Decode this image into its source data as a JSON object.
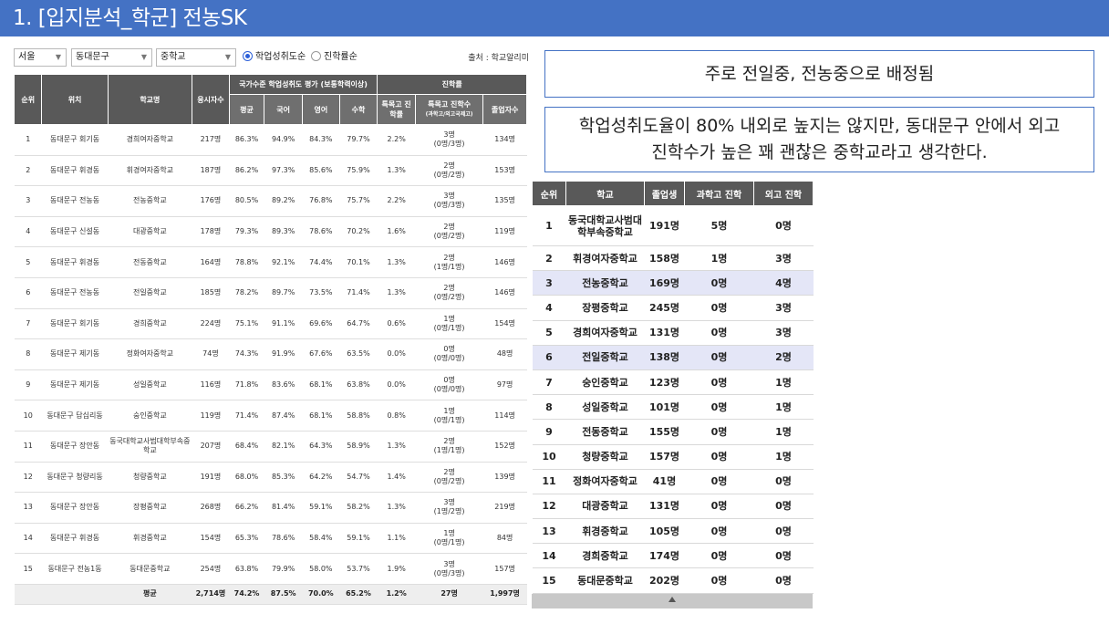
{
  "title": "1. [입지분석_학군] 전농SK",
  "filters": {
    "region": "서울",
    "district": "동대문구",
    "level": "중학교",
    "radio_options": [
      {
        "label": "학업성취도순",
        "selected": true
      },
      {
        "label": "진학률순",
        "selected": false
      }
    ],
    "source": "출처 : 학교알리미"
  },
  "left_table": {
    "headers": {
      "rank": "순위",
      "location": "위치",
      "school": "학교명",
      "students": "응시자수",
      "achievement_group": "국가수준 학업성취도 평가 (보통학력이상)",
      "avg": "평균",
      "korean": "국어",
      "english": "영어",
      "math": "수학",
      "advance_group": "진학률",
      "special_rate": "특목고 진학률",
      "special_count": "특목고 진학수",
      "special_count_sub": "(과학고/외고국제고)",
      "graduates": "졸업자수"
    },
    "rows": [
      {
        "rank": "1",
        "location": "동대문구 회기동",
        "school": "경희여자중학교",
        "students": "217명",
        "avg": "86.3%",
        "korean": "94.9%",
        "english": "84.3%",
        "math": "79.7%",
        "special_rate": "2.2%",
        "special_count": "3명",
        "special_detail": "(0명/3명)",
        "graduates": "134명"
      },
      {
        "rank": "2",
        "location": "동대문구 휘경동",
        "school": "휘경여자중학교",
        "students": "187명",
        "avg": "86.2%",
        "korean": "97.3%",
        "english": "85.6%",
        "math": "75.9%",
        "special_rate": "1.3%",
        "special_count": "2명",
        "special_detail": "(0명/2명)",
        "graduates": "153명"
      },
      {
        "rank": "3",
        "location": "동대문구 전농동",
        "school": "전농중학교",
        "students": "176명",
        "avg": "80.5%",
        "korean": "89.2%",
        "english": "76.8%",
        "math": "75.7%",
        "special_rate": "2.2%",
        "special_count": "3명",
        "special_detail": "(0명/3명)",
        "graduates": "135명"
      },
      {
        "rank": "4",
        "location": "동대문구 신설동",
        "school": "대광중학교",
        "students": "178명",
        "avg": "79.3%",
        "korean": "89.3%",
        "english": "78.6%",
        "math": "70.2%",
        "special_rate": "1.6%",
        "special_count": "2명",
        "special_detail": "(0명/2명)",
        "graduates": "119명"
      },
      {
        "rank": "5",
        "location": "동대문구 휘경동",
        "school": "전동중학교",
        "students": "164명",
        "avg": "78.8%",
        "korean": "92.1%",
        "english": "74.4%",
        "math": "70.1%",
        "special_rate": "1.3%",
        "special_count": "2명",
        "special_detail": "(1명/1명)",
        "graduates": "146명"
      },
      {
        "rank": "6",
        "location": "동대문구 전농동",
        "school": "전일중학교",
        "students": "185명",
        "avg": "78.2%",
        "korean": "89.7%",
        "english": "73.5%",
        "math": "71.4%",
        "special_rate": "1.3%",
        "special_count": "2명",
        "special_detail": "(0명/2명)",
        "graduates": "146명"
      },
      {
        "rank": "7",
        "location": "동대문구 회기동",
        "school": "경희중학교",
        "students": "224명",
        "avg": "75.1%",
        "korean": "91.1%",
        "english": "69.6%",
        "math": "64.7%",
        "special_rate": "0.6%",
        "special_count": "1명",
        "special_detail": "(0명/1명)",
        "graduates": "154명"
      },
      {
        "rank": "8",
        "location": "동대문구 제기동",
        "school": "정화여자중학교",
        "students": "74명",
        "avg": "74.3%",
        "korean": "91.9%",
        "english": "67.6%",
        "math": "63.5%",
        "special_rate": "0.0%",
        "special_count": "0명",
        "special_detail": "(0명/0명)",
        "graduates": "48명"
      },
      {
        "rank": "9",
        "location": "동대문구 제기동",
        "school": "성일중학교",
        "students": "116명",
        "avg": "71.8%",
        "korean": "83.6%",
        "english": "68.1%",
        "math": "63.8%",
        "special_rate": "0.0%",
        "special_count": "0명",
        "special_detail": "(0명/0명)",
        "graduates": "97명"
      },
      {
        "rank": "10",
        "location": "동대문구 답십리동",
        "school": "숭인중학교",
        "students": "119명",
        "avg": "71.4%",
        "korean": "87.4%",
        "english": "68.1%",
        "math": "58.8%",
        "special_rate": "0.8%",
        "special_count": "1명",
        "special_detail": "(0명/1명)",
        "graduates": "114명"
      },
      {
        "rank": "11",
        "location": "동대문구 장안동",
        "school": "동국대학교사범대학부속중학교",
        "students": "207명",
        "avg": "68.4%",
        "korean": "82.1%",
        "english": "64.3%",
        "math": "58.9%",
        "special_rate": "1.3%",
        "special_count": "2명",
        "special_detail": "(1명/1명)",
        "graduates": "152명"
      },
      {
        "rank": "12",
        "location": "동대문구 청량리동",
        "school": "청량중학교",
        "students": "191명",
        "avg": "68.0%",
        "korean": "85.3%",
        "english": "64.2%",
        "math": "54.7%",
        "special_rate": "1.4%",
        "special_count": "2명",
        "special_detail": "(0명/2명)",
        "graduates": "139명"
      },
      {
        "rank": "13",
        "location": "동대문구 장안동",
        "school": "장평중학교",
        "students": "268명",
        "avg": "66.2%",
        "korean": "81.4%",
        "english": "59.1%",
        "math": "58.2%",
        "special_rate": "1.3%",
        "special_count": "3명",
        "special_detail": "(1명/2명)",
        "graduates": "219명"
      },
      {
        "rank": "14",
        "location": "동대문구 휘경동",
        "school": "휘경중학교",
        "students": "154명",
        "avg": "65.3%",
        "korean": "78.6%",
        "english": "58.4%",
        "math": "59.1%",
        "special_rate": "1.1%",
        "special_count": "1명",
        "special_detail": "(0명/1명)",
        "graduates": "84명"
      },
      {
        "rank": "15",
        "location": "동대문구 전농1동",
        "school": "동대문중학교",
        "students": "254명",
        "avg": "63.8%",
        "korean": "79.9%",
        "english": "58.0%",
        "math": "53.7%",
        "special_rate": "1.9%",
        "special_count": "3명",
        "special_detail": "(0명/3명)",
        "graduates": "157명"
      }
    ],
    "footer": {
      "label": "평균",
      "students": "2,714명",
      "avg": "74.2%",
      "korean": "87.5%",
      "english": "70.0%",
      "math": "65.2%",
      "special_rate": "1.2%",
      "special_count": "27명",
      "graduates": "1,997명"
    }
  },
  "callouts": {
    "box1": "주로 전일중, 전농중으로 배정됨",
    "box2_line1": "학업성취도율이 80% 내외로 높지는 않지만, 동대문구 안에서 외고",
    "box2_line2": "진학수가 높은 꽤 괜찮은 중학교라고 생각한다."
  },
  "right_table": {
    "headers": {
      "rank": "순위",
      "school": "학교",
      "graduates": "졸업생",
      "science": "과학고 진학",
      "foreign": "외고 진학"
    },
    "rows": [
      {
        "rank": "1",
        "school": "동국대학교사범대학부속중학교",
        "graduates": "191명",
        "science": "5명",
        "foreign": "0명",
        "highlight": false
      },
      {
        "rank": "2",
        "school": "휘경여자중학교",
        "graduates": "158명",
        "science": "1명",
        "foreign": "3명",
        "highlight": false
      },
      {
        "rank": "3",
        "school": "전농중학교",
        "graduates": "169명",
        "science": "0명",
        "foreign": "4명",
        "highlight": true
      },
      {
        "rank": "4",
        "school": "장평중학교",
        "graduates": "245명",
        "science": "0명",
        "foreign": "3명",
        "highlight": false
      },
      {
        "rank": "5",
        "school": "경희여자중학교",
        "graduates": "131명",
        "science": "0명",
        "foreign": "3명",
        "highlight": false
      },
      {
        "rank": "6",
        "school": "전일중학교",
        "graduates": "138명",
        "science": "0명",
        "foreign": "2명",
        "highlight": true
      },
      {
        "rank": "7",
        "school": "숭인중학교",
        "graduates": "123명",
        "science": "0명",
        "foreign": "1명",
        "highlight": false
      },
      {
        "rank": "8",
        "school": "성일중학교",
        "graduates": "101명",
        "science": "0명",
        "foreign": "1명",
        "highlight": false
      },
      {
        "rank": "9",
        "school": "전동중학교",
        "graduates": "155명",
        "science": "0명",
        "foreign": "1명",
        "highlight": false
      },
      {
        "rank": "10",
        "school": "청량중학교",
        "graduates": "157명",
        "science": "0명",
        "foreign": "1명",
        "highlight": false
      },
      {
        "rank": "11",
        "school": "정화여자중학교",
        "graduates": "41명",
        "science": "0명",
        "foreign": "0명",
        "highlight": false
      },
      {
        "rank": "12",
        "school": "대광중학교",
        "graduates": "131명",
        "science": "0명",
        "foreign": "0명",
        "highlight": false
      },
      {
        "rank": "13",
        "school": "휘경중학교",
        "graduates": "105명",
        "science": "0명",
        "foreign": "0명",
        "highlight": false
      },
      {
        "rank": "14",
        "school": "경희중학교",
        "graduates": "174명",
        "science": "0명",
        "foreign": "0명",
        "highlight": false
      },
      {
        "rank": "15",
        "school": "동대문중학교",
        "graduates": "202명",
        "science": "0명",
        "foreign": "0명",
        "highlight": false
      }
    ]
  },
  "colors": {
    "title_bar": "#4472c4",
    "header_bg": "#595959",
    "highlight_row": "#e4e6f7",
    "callout_border": "#4472c4",
    "radio_selected": "#2b5fd9"
  }
}
